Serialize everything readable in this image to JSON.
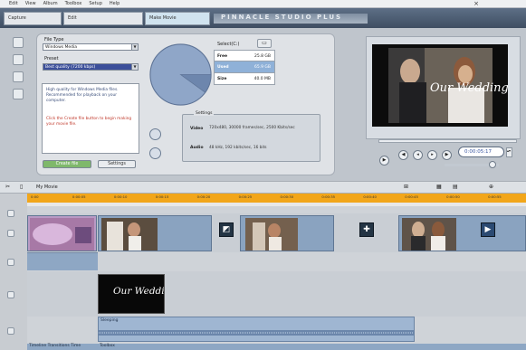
{
  "menu": [
    "Edit",
    "View",
    "Album",
    "Toolbox",
    "Setup",
    "Help"
  ],
  "tabs": [
    "Capture",
    "Edit",
    "Make Movie"
  ],
  "product_title": "PINNACLE STUDIO PLUS",
  "settings": {
    "file_type_label": "File Type",
    "file_type_value": "Windows Media",
    "preset_label": "Preset",
    "preset_value": "Best quality (7200 kbps)",
    "description": "High quality for Windows Media files. Recommended for playback on your computer.",
    "warning": "Click the Create file button to begin making your movie file.",
    "create_button": "Create file",
    "settings_button": "Settings",
    "stats_title": "Select(C:)",
    "stats": [
      {
        "key": "Free",
        "value": "25.8 GB"
      },
      {
        "key": "Used",
        "value": "65.9 GB"
      },
      {
        "key": "Size",
        "value": "40.0 MB"
      }
    ],
    "settings_legend": "Settings",
    "video_label": "Video",
    "video_value": "720x480, 30000 frames/sec, 2500 Kbits/sec",
    "audio_label": "Audio",
    "audio_value": "48 kHz, 192 kbits/sec, 16 bits"
  },
  "pie": {
    "used_fraction": 0.1
  },
  "preview": {
    "timecode": "0:00:05:17",
    "overlay_text": "Our Wedding"
  },
  "timeline": {
    "project_name": "My Movie",
    "ticks": [
      "0:00",
      "0:00:05",
      "0:00:10",
      "0:00:15",
      "0:00:20",
      "0:00:25",
      "0:00:30",
      "0:00:35",
      "0:00:40",
      "0:00:45",
      "0:00:50",
      "0:00:55"
    ],
    "title_text": "Our Wedding",
    "audio_label": "Sleeping",
    "status_left": "Timeline Transitions Time",
    "status_right": "Toolbox"
  },
  "icons": [
    "folder-icon",
    "play-icon",
    "rewind-icon",
    "fast-forward-icon",
    "step-back-icon",
    "step-forward-icon",
    "loop-icon",
    "speaker-icon",
    "camera-icon",
    "title-icon",
    "music-icon"
  ]
}
